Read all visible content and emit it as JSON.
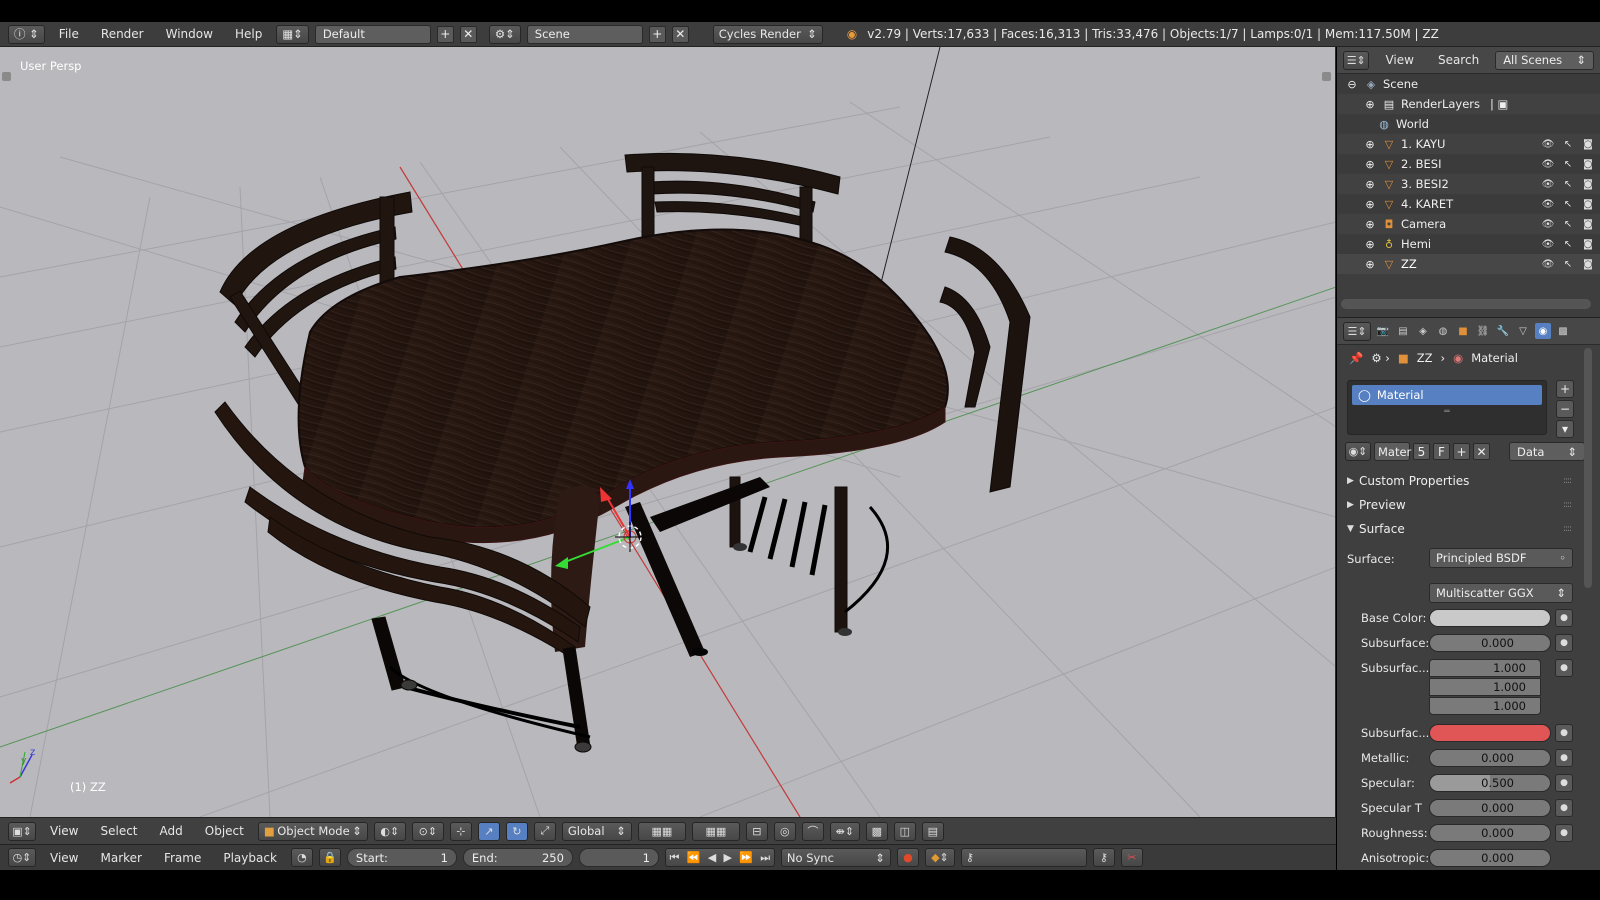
{
  "app": {
    "menus": [
      "File",
      "Render",
      "Window",
      "Help"
    ],
    "layout_name": "Default",
    "scene_name": "Scene",
    "render_engine": "Cycles Render",
    "stats": "v2.79 | Verts:17,633 | Faces:16,313 | Tris:33,476 | Objects:1/7 | Lamps:0/1 | Mem:117.50M | ZZ"
  },
  "viewport": {
    "view_label": "User Persp",
    "object_label": "(1) ZZ",
    "axis_z": "z",
    "axis_y": "y",
    "colors": {
      "background": "#b9b9bd",
      "grid": "#a6a6aa",
      "x_axis": "#c2393a",
      "y_axis": "#3f8a3f",
      "wood": "#2a1a15"
    }
  },
  "view_header": {
    "menus": [
      "View",
      "Select",
      "Add",
      "Object"
    ],
    "mode": "Object Mode",
    "orientation": "Global"
  },
  "timeline": {
    "menus": [
      "View",
      "Marker",
      "Frame",
      "Playback"
    ],
    "start_label": "Start:",
    "start_value": "1",
    "end_label": "End:",
    "end_value": "250",
    "current_frame": "1",
    "sync": "No Sync"
  },
  "outliner": {
    "header": {
      "view": "View",
      "search": "Search",
      "scope": "All Scenes"
    },
    "items": [
      {
        "label": "Scene",
        "icon": "scene-icon",
        "level": 0
      },
      {
        "label": "RenderLayers",
        "icon": "renderlayers-icon",
        "level": 1
      },
      {
        "label": "World",
        "icon": "world-icon",
        "level": 1
      },
      {
        "label": "1. KAYU",
        "icon": "mesh-icon",
        "level": 1
      },
      {
        "label": "2. BESI",
        "icon": "mesh-icon",
        "level": 1
      },
      {
        "label": "3. BESI2",
        "icon": "mesh-icon",
        "level": 1
      },
      {
        "label": "4. KARET",
        "icon": "mesh-icon",
        "level": 1
      },
      {
        "label": "Camera",
        "icon": "camera-icon",
        "level": 1
      },
      {
        "label": "Hemi",
        "icon": "lamp-icon",
        "level": 1
      },
      {
        "label": "ZZ",
        "icon": "mesh-icon",
        "level": 1
      }
    ]
  },
  "properties": {
    "breadcrumb_object": "ZZ",
    "breadcrumb_material": "Material",
    "material_slot": "Material",
    "datablock_name": "Mater",
    "datablock_users": "5",
    "fake_user": "F",
    "link": "Data",
    "panels": {
      "custom_properties": "Custom Properties",
      "preview": "Preview",
      "surface": "Surface"
    },
    "surface_label": "Surface:",
    "surface_shader": "Principled BSDF",
    "distribution": "Multiscatter GGX",
    "base_color_label": "Base Color:",
    "subsurface_label": "Subsurface:",
    "subsurface_value": "0.000",
    "subsurface_radius_label": "Subsurfac...",
    "subsurface_radius": [
      "1.000",
      "1.000",
      "1.000"
    ],
    "subsurface_color_label": "Subsurfac...",
    "subsurface_color": "#e05555",
    "metallic_label": "Metallic:",
    "metallic_value": "0.000",
    "specular_label": "Specular:",
    "specular_value": "0.500",
    "specular_tint_label": "Specular T",
    "specular_tint_value": "0.000",
    "roughness_label": "Roughness:",
    "roughness_value": "0.000",
    "anisotropic_label": "Anisotropic:",
    "anisotropic_value": "0.000"
  }
}
